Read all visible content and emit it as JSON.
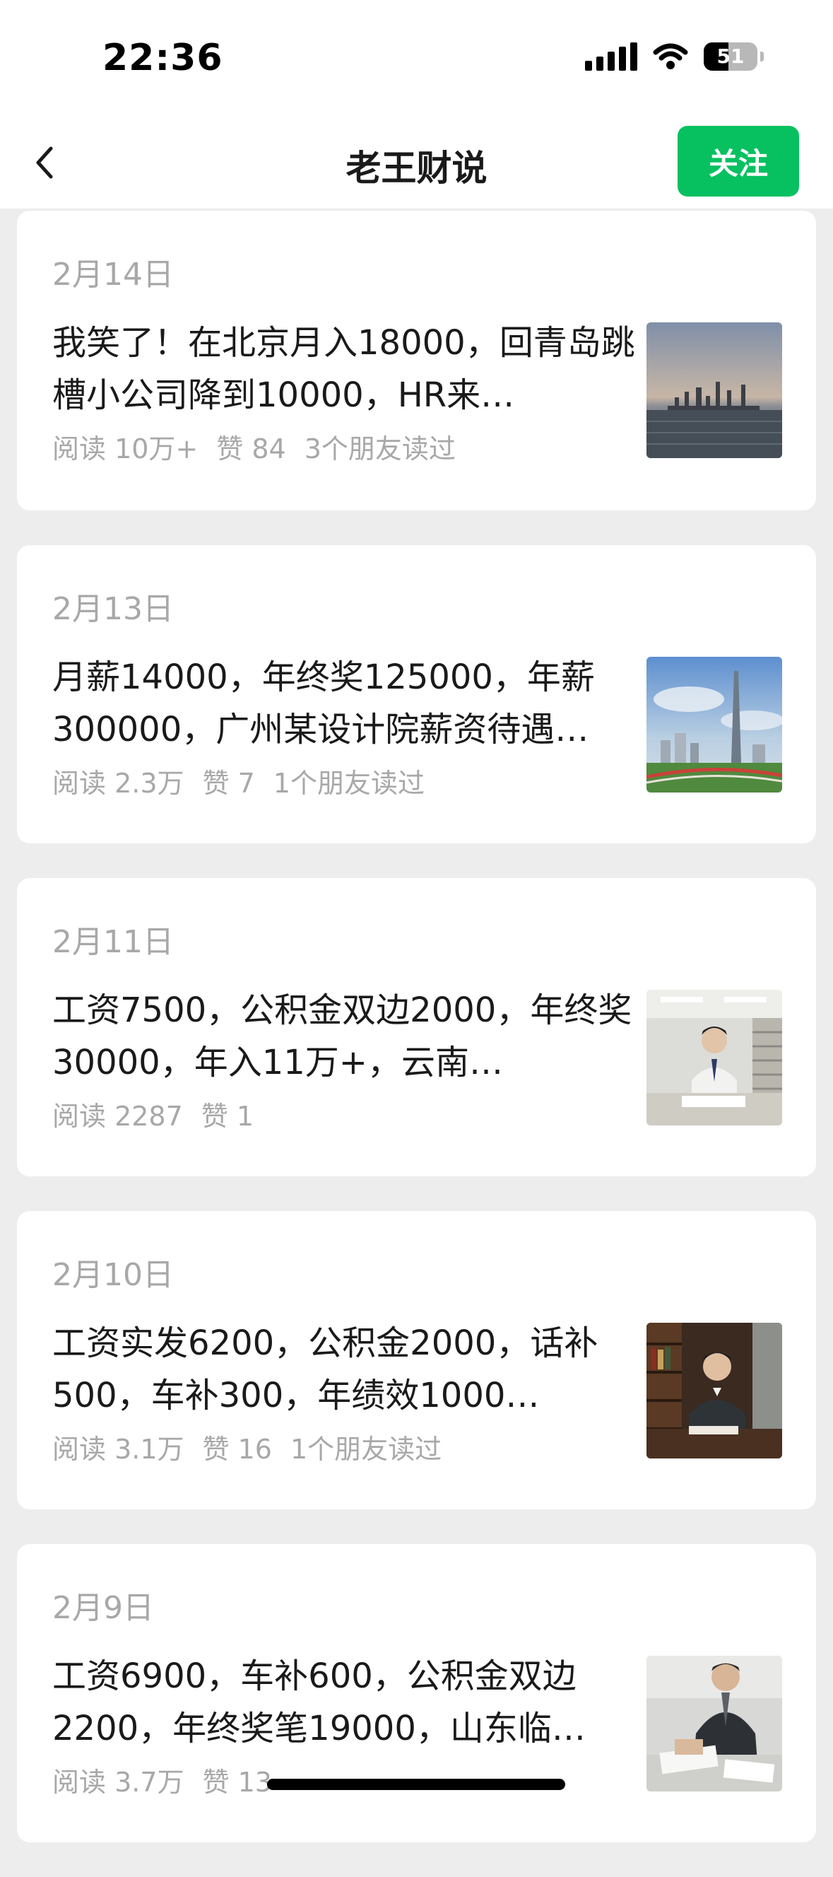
{
  "status": {
    "time": "22:36",
    "battery": "51"
  },
  "nav": {
    "title": "老王财说",
    "follow_label": "关注"
  },
  "articles": [
    {
      "date": "2月14日",
      "title": "我笑了！在北京月入18000，回青岛跳槽小公司降到10000，HR来…",
      "reads": "阅读 10万+",
      "likes": "赞 84",
      "friends": "3个朋友读过",
      "thumb": "city-skyline-image"
    },
    {
      "date": "2月13日",
      "title": "月薪14000，年终奖125000，年薪300000，广州某设计院薪资待遇…",
      "reads": "阅读 2.3万",
      "likes": "赞 7",
      "friends": "1个朋友读过",
      "thumb": "canton-tower-image"
    },
    {
      "date": "2月11日",
      "title": "工资7500，公积金双边2000，年终奖30000，年入11万+，云南…",
      "reads": "阅读 2287",
      "likes": "赞 1",
      "friends": "",
      "thumb": "office-worker-image"
    },
    {
      "date": "2月10日",
      "title": "工资实发6200，公积金2000，话补500，车补300，年绩效1000…",
      "reads": "阅读 3.1万",
      "likes": "赞 16",
      "friends": "1个朋友读过",
      "thumb": "businessman-desk-image"
    },
    {
      "date": "2月9日",
      "title": "工资6900，车补600，公积金双边2200，年终奖笔19000，山东临…",
      "reads": "阅读 3.7万",
      "likes": "赞 13",
      "friends": "",
      "thumb": "suit-man-papers-image"
    }
  ]
}
